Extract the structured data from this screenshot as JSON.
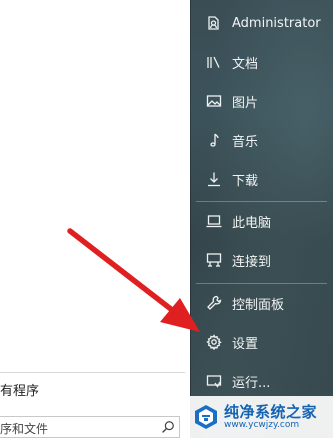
{
  "start_menu": {
    "left": {
      "all_programs": "有程序",
      "search_placeholder": "序和文件"
    },
    "right": {
      "items": [
        {
          "label": "Administrator",
          "icon": "user-icon"
        },
        {
          "label": "文档",
          "icon": "documents-icon"
        },
        {
          "label": "图片",
          "icon": "pictures-icon"
        },
        {
          "label": "音乐",
          "icon": "music-icon"
        },
        {
          "label": "下载",
          "icon": "download-icon"
        },
        {
          "label": "此电脑",
          "icon": "computer-icon"
        },
        {
          "label": "连接到",
          "icon": "connect-icon"
        },
        {
          "label": "控制面板",
          "icon": "wrench-icon"
        },
        {
          "label": "设置",
          "icon": "gear-icon"
        },
        {
          "label": "运行...",
          "icon": "run-icon"
        }
      ]
    }
  },
  "watermark": {
    "title": "纯净系统之家",
    "url": "www.ycwjzy.com"
  },
  "colors": {
    "pane_dark": "#3a4d55",
    "arrow": "#e02020",
    "watermark_blue": "#1463b3"
  }
}
